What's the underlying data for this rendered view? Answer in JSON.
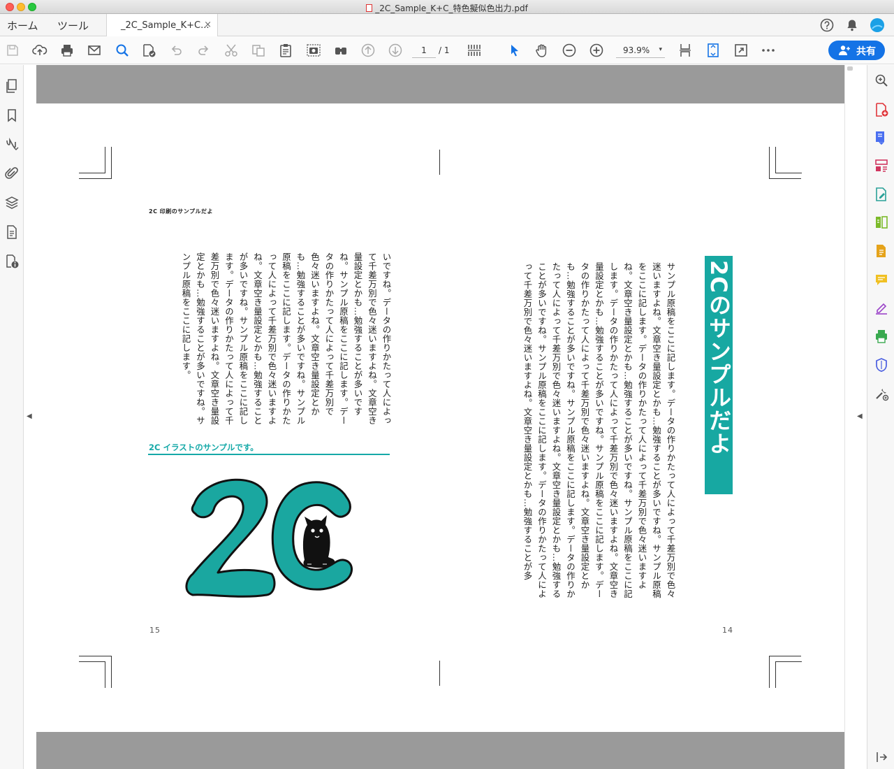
{
  "window": {
    "title": "_2C_Sample_K+C_特色擬似色出力.pdf"
  },
  "tabs": {
    "home": "ホーム",
    "tools": "ツール",
    "document": "_2C_Sample_K+C...",
    "close": "×"
  },
  "toolbar": {
    "page_current": "1",
    "page_total": "/ 1",
    "zoom": "93.9%",
    "zoom_caret": "▾",
    "share_label": "共有"
  },
  "rails": {
    "collapse_left": "◀",
    "collapse_right": "◀"
  },
  "document": {
    "running_head": "2C 印刷のサンプルだよ",
    "left_page": {
      "body_text": "いですね。データの作りかたって人によって千差万別で色々迷いますよね。文章空き量設定とかも…勉強することが多いですね。サンプル原稿をここに記します。データの作りかたって人によって千差万別で色々迷いますよね。文章空き量設定とかも…勉強することが多いですね。サンプル原稿をここに記します。データの作りかたって人によって千差万別で色々迷いますよね。文章空き量設定とかも…勉強することが多いですね。サンプル原稿をここに記します。データの作りかたって人によって千差万別で色々迷いますよね。文章空き量設定とかも…勉強することが多いですね。サンプル原稿をここに記します。",
      "sub_heading": "2C イラストのサンプルです。",
      "folio": "15"
    },
    "right_page": {
      "title": "2Cのサンプルだよ",
      "body_text": "サンプル原稿をここに記します。データの作りかたって人によって千差万別で色々迷いますよね。文章空き量設定とかも…勉強することが多いですね。サンプル原稿をここに記します。データの作りかたって人によって千差万別で色々迷いますよね。文章空き量設定とかも…勉強することが多いですね。サンプル原稿をここに記します。データの作りかたって人によって千差万別で色々迷いますよね。文章空き量設定とかも…勉強することが多いですね。サンプル原稿をここに記します。データの作りかたって人によって千差万別で色々迷いますよね。文章空き量設定とかも…勉強することが多いですね。サンプル原稿をここに記します。データの作りかたって人によって千差万別で色々迷いますよね。文章空き量設定とかも…勉強することが多いですね。サンプル原稿をここに記します。データの作りかたって人によって千差万別で色々迷いますよね。文章空き量設定とかも…勉強することが多",
      "folio": "14"
    }
  },
  "colors": {
    "accent": "#1473e6",
    "spot_teal": "#17a8a2"
  }
}
